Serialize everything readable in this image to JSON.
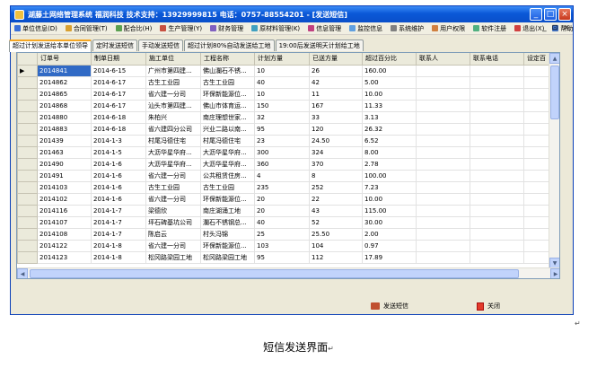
{
  "window": {
    "title": "湖藤土网络管理系统    福润科技  技术支持：13929999815    电话：0757-88554201  - [发送短信]",
    "controls": [
      "_",
      "□",
      "×"
    ]
  },
  "menu": {
    "items": [
      {
        "label": "单位信息(D)",
        "color": "#3a6fd8"
      },
      {
        "label": "合同管理(T)",
        "color": "#d8a030"
      },
      {
        "label": "配合比(H)",
        "color": "#5aa050"
      },
      {
        "label": "生产管理(Y)",
        "color": "#c85040"
      },
      {
        "label": "财务管理",
        "color": "#8060c0"
      },
      {
        "label": "原材料管理(K)",
        "color": "#40a0c0"
      },
      {
        "label": "信息管理",
        "color": "#c04080"
      },
      {
        "label": "监控信息",
        "color": "#60a0e0"
      },
      {
        "label": "系统维护",
        "color": "#808080"
      },
      {
        "label": "用户权限",
        "color": "#d08040"
      },
      {
        "label": "软件注册",
        "color": "#50b080"
      },
      {
        "label": "退出(X)",
        "color": "#d04040"
      },
      {
        "label": "帮助",
        "color": "#4070c0"
      }
    ],
    "mdi_controls": [
      "_",
      "⊡",
      "×"
    ]
  },
  "tabs": [
    {
      "label": "超过计划发送给本单位领导",
      "active": true
    },
    {
      "label": "定时发送短信",
      "active": false
    },
    {
      "label": "手动发送短信",
      "active": false
    },
    {
      "label": "超过计划80%自动发送给工地",
      "active": false
    },
    {
      "label": "19:00后发送明天计划给工地",
      "active": false
    }
  ],
  "grid": {
    "columns": [
      "订单号",
      "制单日期",
      "施工单位",
      "工程名称",
      "计划方量",
      "已送方量",
      "超过百分比",
      "联系人",
      "联系电话",
      "设定百"
    ],
    "rows": [
      [
        "2014841",
        "2014-6-15",
        "广州市第四建...",
        "佛山瀾石不锈...",
        "10",
        "26",
        "160.00",
        "",
        ""
      ],
      [
        "2014862",
        "2014-6-17",
        "古生工业园",
        "古生工业园",
        "40",
        "42",
        "5.00",
        "",
        ""
      ],
      [
        "2014865",
        "2014-6-17",
        "省六建一分司",
        "环保新能源位...",
        "10",
        "11",
        "10.00",
        "",
        ""
      ],
      [
        "2014868",
        "2014-6-17",
        "汕头市第四建...",
        "佛山市体育运...",
        "150",
        "167",
        "11.33",
        "",
        ""
      ],
      [
        "2014880",
        "2014-6-18",
        "朱柏兴",
        "南庄理想世家...",
        "32",
        "33",
        "3.13",
        "",
        ""
      ],
      [
        "2014883",
        "2014-6-18",
        "省六建四分公司",
        "兴业二路以南...",
        "95",
        "120",
        "26.32",
        "",
        ""
      ],
      [
        "201439",
        "2014-1-3",
        "村尾冯德住宅",
        "村尾冯德住宅",
        "23",
        "24.50",
        "6.52",
        "",
        ""
      ],
      [
        "201463",
        "2014-1-5",
        "大沥华星华府...",
        "大沥华星华府...",
        "300",
        "324",
        "8.00",
        "",
        ""
      ],
      [
        "201490",
        "2014-1-6",
        "大沥华星华府...",
        "大沥华星华府...",
        "360",
        "370",
        "2.78",
        "",
        ""
      ],
      [
        "201491",
        "2014-1-6",
        "省六建一分司",
        "公共租赁住房...",
        "4",
        "8",
        "100.00",
        "",
        ""
      ],
      [
        "2014103",
        "2014-1-6",
        "古生工业园",
        "古生工业园",
        "235",
        "252",
        "7.23",
        "",
        ""
      ],
      [
        "2014102",
        "2014-1-6",
        "省六建一分司",
        "环保新能源位...",
        "20",
        "22",
        "10.00",
        "",
        ""
      ],
      [
        "2014116",
        "2014-1-7",
        "梁德欣",
        "南庄湖涌工地",
        "20",
        "43",
        "115.00",
        "",
        ""
      ],
      [
        "2014107",
        "2014-1-7",
        "坪石碑基坑公司",
        "瀾石不锈钢总...",
        "40",
        "52",
        "30.00",
        "",
        ""
      ],
      [
        "2014108",
        "2014-1-7",
        "陈启云",
        "村头冯锦",
        "25",
        "25.50",
        "2.00",
        "",
        ""
      ],
      [
        "2014122",
        "2014-1-8",
        "省六建一分司",
        "环保新能源位...",
        "103",
        "104",
        "0.97",
        "",
        ""
      ],
      [
        "2014123",
        "2014-1-8",
        "松冈路梁园工地",
        "松冈路梁园工地",
        "95",
        "112",
        "17.89",
        "",
        ""
      ]
    ],
    "selected_row_marker": "▶"
  },
  "actions": {
    "send_label": "发送短信",
    "close_label": "关闭"
  },
  "caption": "短信发送界面"
}
